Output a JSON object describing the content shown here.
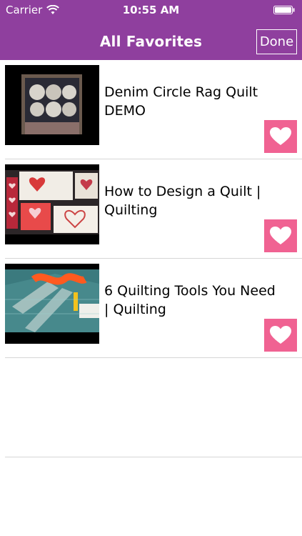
{
  "status_bar": {
    "carrier": "Carrier",
    "time": "10:55 AM"
  },
  "nav": {
    "title": "All Favorites",
    "done_label": "Done"
  },
  "colors": {
    "header": "#8f3f9e",
    "favorite": "#f06292"
  },
  "items": [
    {
      "title": "Denim Circle Rag Quilt DEMO",
      "favorite_icon": "heart-icon"
    },
    {
      "title": "How to Design a Quilt | Quilting",
      "favorite_icon": "heart-icon"
    },
    {
      "title": "6 Quilting Tools You Need | Quilting",
      "favorite_icon": "heart-icon"
    }
  ]
}
